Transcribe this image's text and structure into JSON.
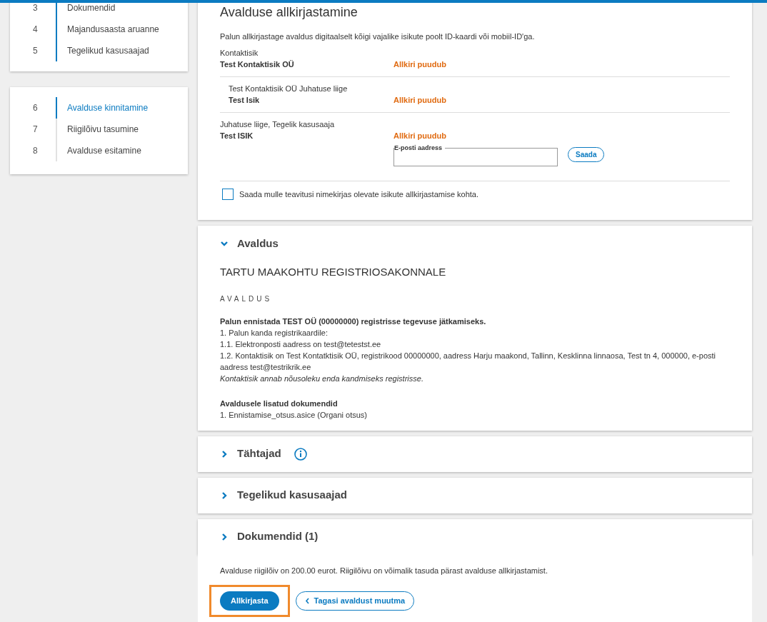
{
  "sidebar": {
    "groups": [
      {
        "items": [
          {
            "number": "3",
            "label": "Dokumendid",
            "completed": true,
            "selected": false
          },
          {
            "number": "4",
            "label": "Majandusaasta aruanne",
            "completed": true,
            "selected": false
          },
          {
            "number": "5",
            "label": "Tegelikud kasusaajad",
            "completed": true,
            "selected": false
          }
        ]
      },
      {
        "items": [
          {
            "number": "6",
            "label": "Avalduse kinnitamine",
            "completed": true,
            "selected": true
          },
          {
            "number": "7",
            "label": "Riigilõivu tasumine",
            "completed": false,
            "selected": false
          },
          {
            "number": "8",
            "label": "Avalduse esitamine",
            "completed": false,
            "selected": false
          }
        ]
      }
    ]
  },
  "signing": {
    "title": "Avalduse allkirjastamine",
    "intro": "Palun allkirjastage avaldus digitaalselt kõigi vajalike isikute poolt ID-kaardi või mobiil-ID'ga.",
    "signers": [
      {
        "role": "Kontaktisik",
        "name": "Test Kontaktisik OÜ",
        "status": "Allkiri puudub",
        "children": [
          {
            "role": "Test Kontaktisik OÜ Juhatuse liige",
            "name": "Test Isik",
            "status": "Allkiri puudub"
          }
        ]
      },
      {
        "role": "Juhatuse liige, Tegelik kasusaaja",
        "name": "Test ISIK",
        "status": "Allkiri puudub",
        "email_field": {
          "label": "E-posti aadress"
        },
        "send_button": "Saada"
      }
    ],
    "notify": {
      "label": "Saada mulle teavitusi nimekirjas olevate isikute allkirjastamise kohta.",
      "checked": false
    }
  },
  "sections": [
    {
      "title": "Avaldus",
      "expanded": true,
      "info": false,
      "content": {
        "addressee": "TARTU MAAKOHTU REGISTRIOSAKONNALE",
        "heading": "AVALDUS",
        "lines": [
          {
            "kind": "bold",
            "text": "Palun ennistada TEST OÜ (00000000) registrisse tegevuse jätkamiseks."
          },
          {
            "kind": "plain",
            "text": "1. Palun kanda registrikaardile:"
          },
          {
            "kind": "plain",
            "text": "1.1. Elektronposti aadress on test@tetestst.ee"
          },
          {
            "kind": "plain",
            "text": "1.2. Kontaktisik on Test Kontatktisik OÜ, registrikood 00000000, aadress Harju maakond, Tallinn, Kesklinna linnaosa, Test tn 4, 000000, e-posti aadress test@testrikrik.ee"
          },
          {
            "kind": "italic",
            "text": "Kontaktisik annab nõusoleku enda kandmiseks registrisse."
          },
          {
            "kind": "subheading",
            "text": "Avaldusele lisatud dokumendid"
          },
          {
            "kind": "plain",
            "text": "1. Ennistamise_otsus.asice (Organi otsus)"
          }
        ]
      }
    },
    {
      "title": "Tähtajad",
      "expanded": false,
      "info": true
    },
    {
      "title": "Tegelikud kasusaajad",
      "expanded": false,
      "info": false
    },
    {
      "title": "Dokumendid (1)",
      "expanded": false,
      "info": false
    }
  ],
  "footer": {
    "note": "Avalduse riigilõiv on 200.00 eurot. Riigilõivu on võimalik tasuda pärast avalduse allkirjastamist.",
    "buttons": [
      {
        "kind": "primary",
        "label": "Allkirjasta",
        "highlighted": true
      },
      {
        "kind": "back",
        "label": "Tagasi avaldust muutma",
        "highlighted": false
      }
    ]
  }
}
